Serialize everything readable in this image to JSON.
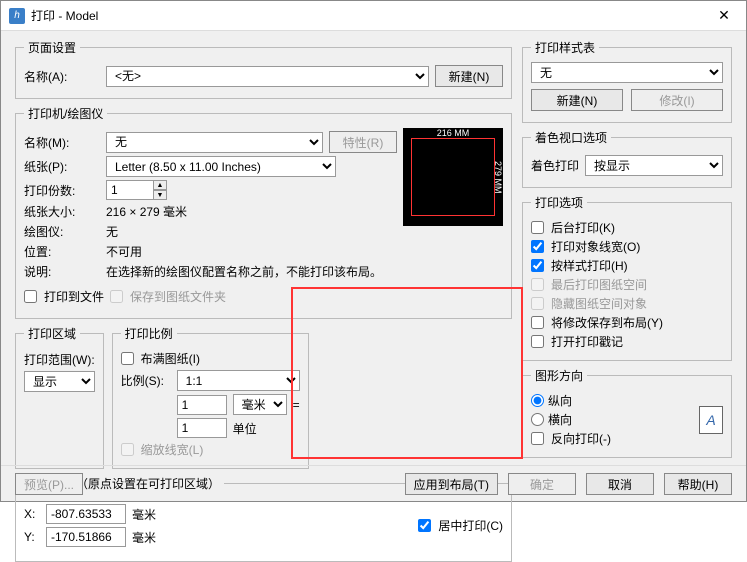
{
  "window": {
    "title": "打印 - Model"
  },
  "page_setup": {
    "legend": "页面设置",
    "name_label": "名称(A):",
    "name_value": "<无>",
    "new_btn": "新建(N)"
  },
  "printer": {
    "legend": "打印机/绘图仪",
    "name_label": "名称(M):",
    "name_value": "无",
    "props_btn": "特性(R)",
    "paper_label": "纸张(P):",
    "paper_value": "Letter (8.50 x 11.00 Inches)",
    "copies_label": "打印份数:",
    "copies_value": "1",
    "size_label": "纸张大小:",
    "size_value": "216 × 279  毫米",
    "plotter_label": "绘图仪:",
    "plotter_value": "无",
    "location_label": "位置:",
    "location_value": "不可用",
    "desc_label": "说明:",
    "desc_value": "在选择新的绘图仪配置名称之前，不能打印该布局。",
    "dim_top": "216 MM",
    "dim_right": "279 MM",
    "cb_tofile": "打印到文件",
    "cb_savefolder": "保存到图纸文件夹"
  },
  "area": {
    "legend": "打印区域",
    "range_label": "打印范围(W):",
    "range_value": "显示"
  },
  "scale": {
    "legend": "打印比例",
    "fit_cb": "布满图纸(I)",
    "ratio_label": "比例(S):",
    "ratio_value": "1:1",
    "unit1_value": "1",
    "unit1_sel": "毫米",
    "eq": "=",
    "unit2_value": "1",
    "unit2_label": "单位",
    "scale_lw": "缩放线宽(L)"
  },
  "offset": {
    "legend": "打印偏移（原点设置在可打印区域）",
    "x_label": "X:",
    "x_value": "-807.63533",
    "x_unit": "毫米",
    "y_label": "Y:",
    "y_value": "-170.51866",
    "y_unit": "毫米",
    "center_cb": "居中打印(C)"
  },
  "styles": {
    "legend": "打印样式表",
    "value": "无",
    "new_btn": "新建(N)",
    "edit_btn": "修改(I)"
  },
  "shaded": {
    "legend": "着色视口选项",
    "label": "着色打印",
    "value": "按显示"
  },
  "options": {
    "legend": "打印选项",
    "bg": "后台打印(K)",
    "lw": "打印对象线宽(O)",
    "style": "按样式打印(H)",
    "last": "最后打印图纸空间",
    "hide": "隐藏图纸空间对象",
    "save": "将修改保存到布局(Y)",
    "stamp": "打开打印戳记"
  },
  "orient": {
    "legend": "图形方向",
    "portrait": "纵向",
    "landscape": "横向",
    "reverse": "反向打印(-)"
  },
  "footer": {
    "preview": "预览(P)...",
    "apply": "应用到布局(T)",
    "ok": "确定",
    "cancel": "取消",
    "help": "帮助(H)"
  }
}
